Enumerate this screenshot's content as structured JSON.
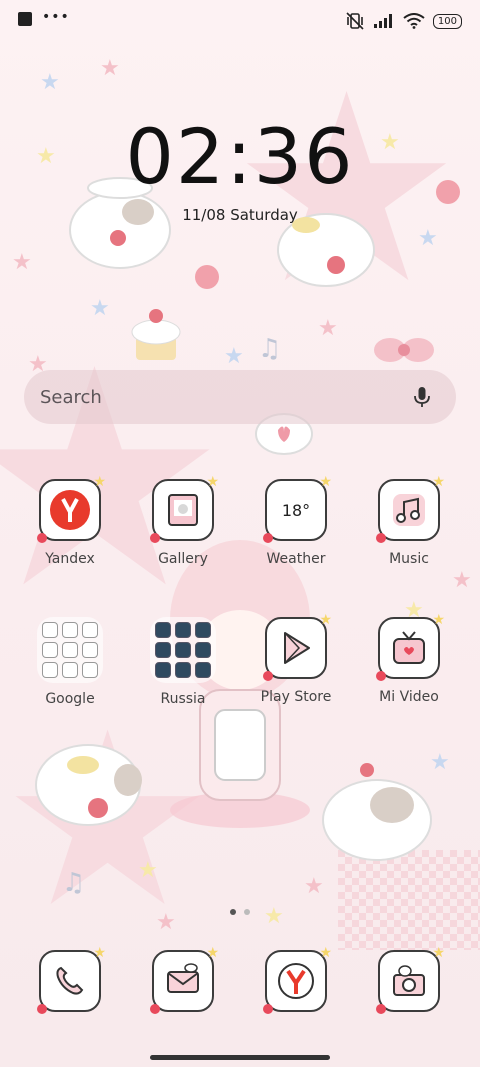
{
  "status_bar": {
    "battery": "100"
  },
  "lockscreen": {
    "time": "02:36",
    "date": "11/08 Saturday"
  },
  "search": {
    "placeholder": "Search"
  },
  "apps": [
    {
      "label": "Yandex"
    },
    {
      "label": "Gallery"
    },
    {
      "label": "Weather",
      "temp": "18°"
    },
    {
      "label": "Music"
    },
    {
      "label": "Google"
    },
    {
      "label": "Russia"
    },
    {
      "label": "Play Store"
    },
    {
      "label": "Mi Video"
    }
  ],
  "dock": [
    {
      "icon": "phone-icon"
    },
    {
      "icon": "messages-icon"
    },
    {
      "icon": "yandex-browser-icon"
    },
    {
      "icon": "camera-icon"
    }
  ],
  "pager": {
    "pages": 2,
    "active": 1
  },
  "colors": {
    "accent_red": "#e8495b",
    "sparkle": "#f5d66b",
    "background": "#fbeef0"
  }
}
